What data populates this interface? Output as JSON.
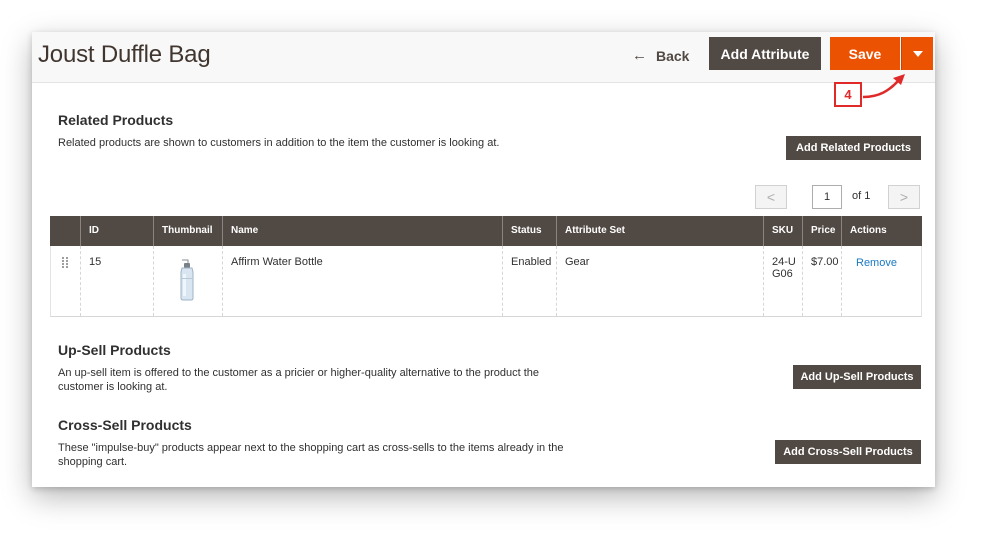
{
  "header": {
    "title": "Joust Duffle Bag",
    "back_label": "Back",
    "add_attribute_label": "Add Attribute",
    "save_label": "Save"
  },
  "annotation": {
    "step": "4"
  },
  "related": {
    "title": "Related Products",
    "description": "Related products are shown to customers in addition to the item the customer is looking at.",
    "button_label": "Add Related Products",
    "pager": {
      "prev": "<",
      "page": "1",
      "of_label": "of 1",
      "next": ">"
    },
    "columns": [
      "",
      "ID",
      "Thumbnail",
      "Name",
      "Status",
      "Attribute Set",
      "SKU",
      "Price",
      "Actions"
    ],
    "rows": [
      {
        "id": "15",
        "name": "Affirm Water Bottle",
        "status": "Enabled",
        "attribute_set": "Gear",
        "sku": "24-UG06",
        "price": "$7.00",
        "action": "Remove"
      }
    ]
  },
  "upsell": {
    "title": "Up-Sell Products",
    "description": "An up-sell item is offered to the customer as a pricier or higher-quality alternative to the product the customer is looking at.",
    "button_label": "Add Up-Sell Products"
  },
  "crosssell": {
    "title": "Cross-Sell Products",
    "description": "These \"impulse-buy\" products appear next to the shopping cart as cross-sells to the items already in the shopping cart.",
    "button_label": "Add Cross-Sell Products"
  },
  "colors": {
    "accent": "#eb5202",
    "dark_button": "#514943",
    "annotation": "#e02a2a",
    "link": "#1979c3"
  },
  "icons": {
    "back": "left-arrow-icon",
    "save_dropdown": "caret-down-icon",
    "drag": "drag-handle-icon",
    "thumbnail": "water-bottle-thumbnail"
  }
}
